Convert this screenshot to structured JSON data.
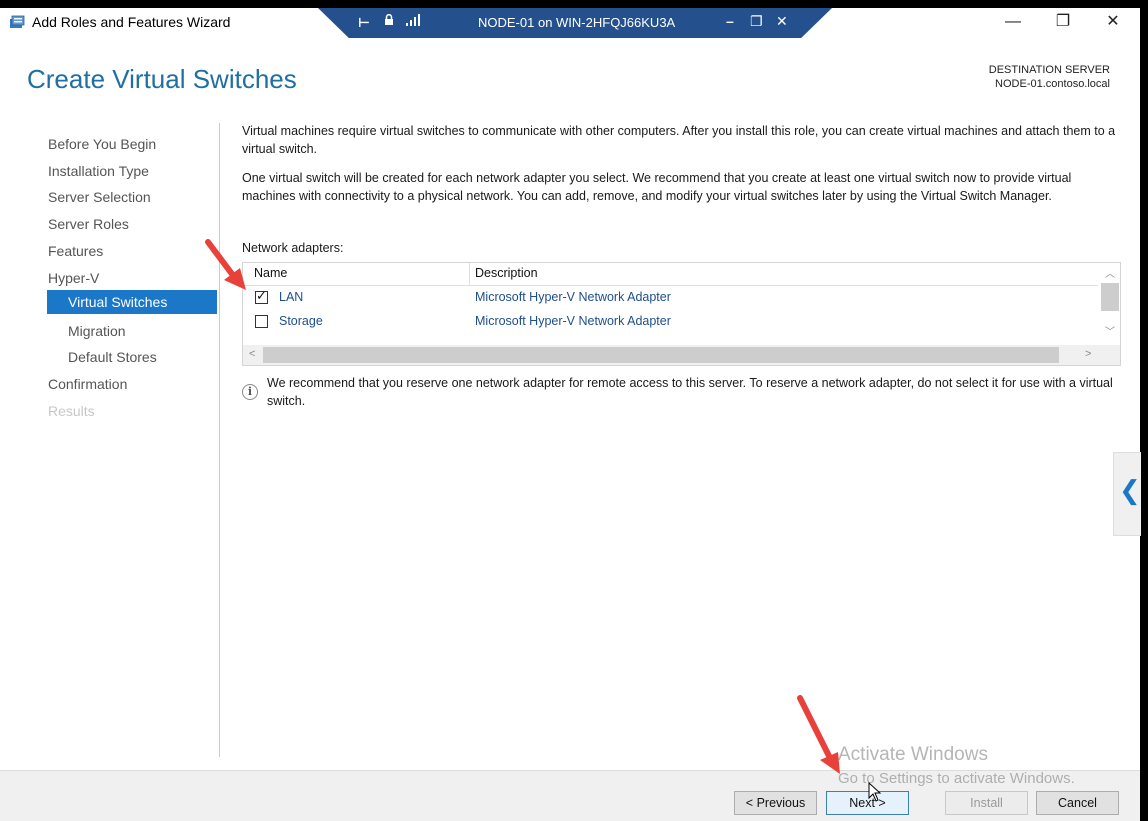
{
  "window": {
    "title": "Add Roles and Features Wizard",
    "icons": [
      "server-manager-icon",
      "minimize-icon",
      "restore-icon",
      "close-icon"
    ],
    "controls": {
      "minimize": "—",
      "restore": "❐",
      "close": "✕"
    }
  },
  "rdp_bar": {
    "title": "NODE-01 on WIN-2HFQJ66KU3A",
    "icons": [
      "pin-icon",
      "lock-icon",
      "signal-icon",
      "minimize-icon",
      "restore-icon",
      "close-icon"
    ],
    "controls": {
      "pin": "⊢",
      "minimize": "–",
      "restore": "❐",
      "close": "✕"
    }
  },
  "header": {
    "page_title": "Create Virtual Switches",
    "destination_label": "DESTINATION SERVER",
    "destination_server": "NODE-01.contoso.local"
  },
  "nav": {
    "items": [
      {
        "label": "Before You Begin",
        "state": "normal"
      },
      {
        "label": "Installation Type",
        "state": "normal"
      },
      {
        "label": "Server Selection",
        "state": "normal"
      },
      {
        "label": "Server Roles",
        "state": "normal"
      },
      {
        "label": "Features",
        "state": "normal"
      },
      {
        "label": "Hyper-V",
        "state": "normal"
      },
      {
        "label": "Virtual Switches",
        "state": "active"
      },
      {
        "label": "Migration",
        "state": "normal"
      },
      {
        "label": "Default Stores",
        "state": "normal"
      },
      {
        "label": "Confirmation",
        "state": "normal"
      },
      {
        "label": "Results",
        "state": "disabled"
      }
    ]
  },
  "content": {
    "intro": "Virtual machines require virtual switches to communicate with other computers. After you install this role, you can create virtual machines and attach them to a virtual switch.",
    "detail": "One virtual switch will be created for each network adapter you select. We recommend that you create at least one virtual switch now to provide virtual machines with connectivity to a physical network. You can add, remove, and modify your virtual switches later by using the Virtual Switch Manager.",
    "adapters_label": "Network adapters:",
    "columns": {
      "name": "Name",
      "description": "Description"
    },
    "adapters": [
      {
        "name": "LAN",
        "description": "Microsoft Hyper-V Network Adapter",
        "checked": true
      },
      {
        "name": "Storage",
        "description": "Microsoft Hyper-V Network Adapter",
        "checked": false
      }
    ],
    "info_icon": "i",
    "note": "We recommend that you reserve one network adapter for remote access to this server. To reserve a network adapter, do not select it for use with a virtual switch."
  },
  "side_tab": {
    "glyph": "❮",
    "icon": "chevron-left-icon"
  },
  "footer": {
    "previous": "< Previous",
    "next": "Next >",
    "install": "Install",
    "cancel": "Cancel"
  },
  "watermark": {
    "line1": "Activate Windows",
    "line2": "Go to Settings to activate Windows."
  },
  "colors": {
    "title": "#1f6fa3",
    "nav_active": "#1b77c7",
    "rdp_bar": "#24508d",
    "annotation_arrow": "#e8413a"
  }
}
